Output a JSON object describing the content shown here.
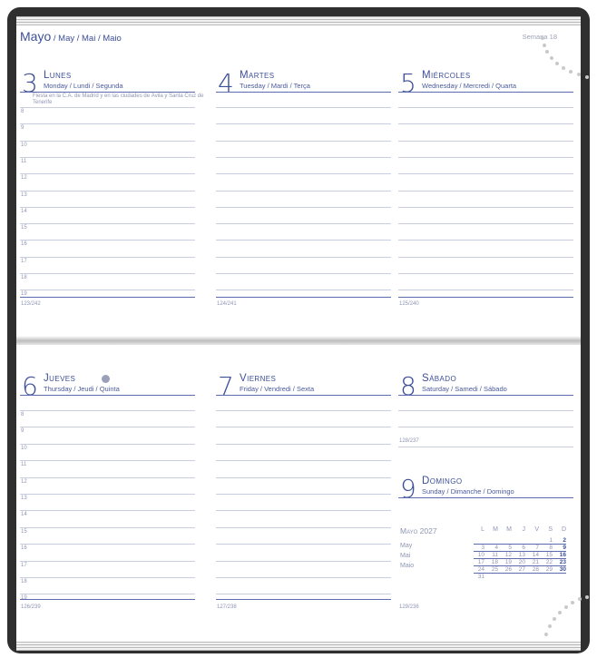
{
  "header": {
    "month": "Mayo",
    "month_sub": " / May / Mai / Maio",
    "week": "Semana 18"
  },
  "days": [
    {
      "num": "3",
      "name": "Lunes",
      "sub": "Monday / Lundi / Segunda",
      "note": "Fiesta en la C.A. de Madrid y en las ciudades de Ávila y Santa Cruz de Tenerife",
      "foot": "123/242"
    },
    {
      "num": "4",
      "name": "Martes",
      "sub": "Tuesday / Mardi / Terça",
      "foot": "124/241"
    },
    {
      "num": "5",
      "name": "Miércoles",
      "sub": "Wednesday / Mercredi / Quarta",
      "foot": "125/240"
    },
    {
      "num": "6",
      "name": "Jueves",
      "sub": "Thursday / Jeudi / Quinta",
      "foot": "126/239"
    },
    {
      "num": "7",
      "name": "Viernes",
      "sub": "Friday / Vendredi / Sexta",
      "foot": "127/238"
    },
    {
      "num": "8",
      "name": "Sábado",
      "sub": "Saturday / Samedi / Sábado",
      "foot": "128/237"
    },
    {
      "num": "9",
      "name": "Domingo",
      "sub": "Sunday / Dimanche / Domingo",
      "foot": "129/236"
    }
  ],
  "hours": [
    "8",
    "9",
    "10",
    "11",
    "12",
    "13",
    "14",
    "15",
    "16",
    "17",
    "18",
    "19"
  ],
  "mini_calendar": {
    "title": "Mayo 2027",
    "sub": [
      "May",
      "Mai",
      "Maio"
    ],
    "headers": [
      "L",
      "M",
      "M",
      "J",
      "V",
      "S",
      "D"
    ],
    "rows": [
      [
        "",
        "",
        "",
        "",
        "",
        "1",
        "2"
      ],
      [
        "3",
        "4",
        "5",
        "6",
        "7",
        "8",
        "9"
      ],
      [
        "10",
        "11",
        "12",
        "13",
        "14",
        "15",
        "16"
      ],
      [
        "17",
        "18",
        "19",
        "20",
        "21",
        "22",
        "23"
      ],
      [
        "24",
        "25",
        "26",
        "27",
        "28",
        "29",
        "30"
      ],
      [
        "31",
        "",
        "",
        "",
        "",
        "",
        ""
      ]
    ]
  }
}
